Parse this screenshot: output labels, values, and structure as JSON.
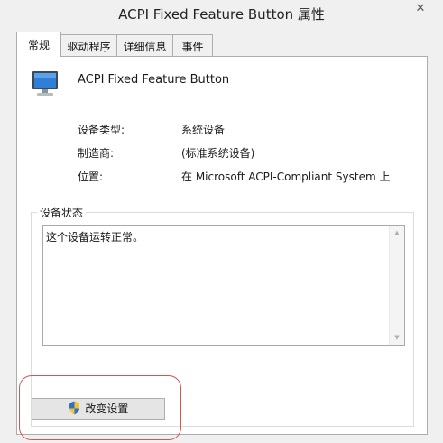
{
  "window": {
    "title": "ACPI Fixed Feature Button 属性",
    "close_glyph": "✕"
  },
  "tabs": [
    {
      "label": "常规",
      "active": true
    },
    {
      "label": "驱动程序",
      "active": false
    },
    {
      "label": "详细信息",
      "active": false
    },
    {
      "label": "事件",
      "active": false
    }
  ],
  "device": {
    "icon": "computer-monitor-icon",
    "name": "ACPI Fixed Feature Button"
  },
  "properties": [
    {
      "label": "设备类型:",
      "value": "系统设备"
    },
    {
      "label": "制造商:",
      "value": "(标准系统设备)"
    },
    {
      "label": "位置:",
      "value": "在 Microsoft ACPI-Compliant System 上"
    }
  ],
  "status_group": {
    "legend": "设备状态",
    "text": "这个设备运转正常。"
  },
  "change_settings_button": {
    "label": "改变设置",
    "icon": "uac-shield-icon"
  },
  "colors": {
    "highlight": "#d9534f",
    "panel": "#ffffff",
    "window": "#f0f0f0"
  }
}
